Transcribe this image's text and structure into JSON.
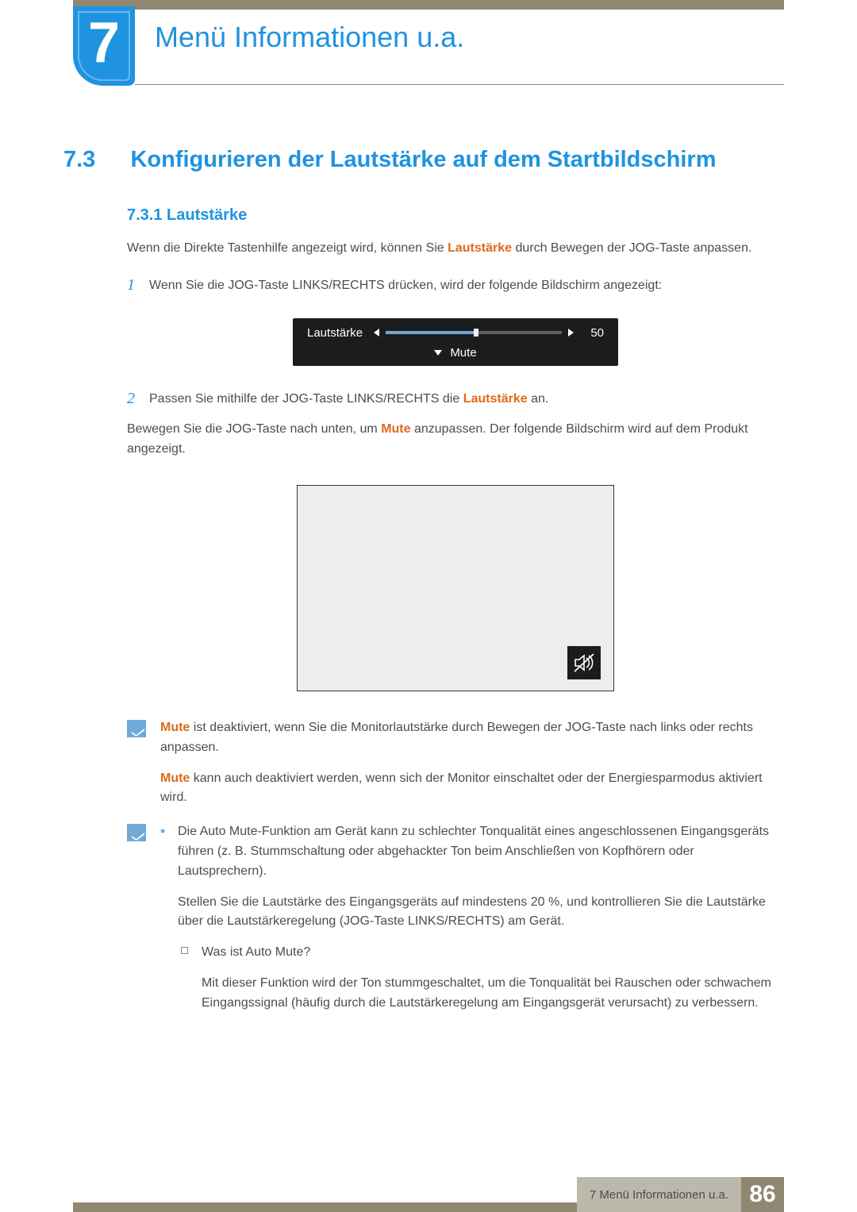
{
  "chapter": {
    "number": "7",
    "title": "Menü Informationen u.a."
  },
  "section": {
    "number": "7.3",
    "title": "Konfigurieren der Lautstärke auf dem Startbildschirm"
  },
  "subsection": {
    "number": "7.3.1",
    "title": "Lautstärke",
    "heading": "7.3.1   Lautstärke"
  },
  "intro": {
    "part1": "Wenn die Direkte Tastenhilfe angezeigt wird, können Sie ",
    "kw": "Lautstärke",
    "part2": " durch Bewegen der JOG-Taste anpassen."
  },
  "step1": {
    "num": "1",
    "text": "Wenn Sie die JOG-Taste LINKS/RECHTS drücken, wird der folgende Bildschirm angezeigt:"
  },
  "osd": {
    "label": "Lautstärke",
    "value": "50",
    "mute": "Mute"
  },
  "step2": {
    "num": "2",
    "part1": "Passen Sie mithilfe der JOG-Taste LINKS/RECHTS die ",
    "kw": "Lautstärke",
    "part2": " an."
  },
  "afterStep2": {
    "part1": "Bewegen Sie die JOG-Taste nach unten, um ",
    "kw": "Mute",
    "part2": " anzupassen. Der folgende Bildschirm wird auf dem Produkt angezeigt."
  },
  "note1": {
    "p1": {
      "kw": "Mute",
      "rest": " ist deaktiviert, wenn Sie die Monitorlautstärke durch Bewegen der JOG-Taste nach links oder rechts anpassen."
    },
    "p2": {
      "kw": "Mute",
      "rest": " kann auch deaktiviert werden, wenn sich der Monitor einschaltet oder der Energiesparmodus aktiviert wird."
    }
  },
  "note2": {
    "b1": "Die Auto Mute-Funktion am Gerät kann zu schlechter Tonqualität eines angeschlossenen Eingangsgeräts führen (z. B. Stummschaltung oder abgehackter Ton beim Anschließen von Kopfhörern oder Lautsprechern).",
    "b1b": "Stellen Sie die Lautstärke des Eingangsgeräts auf mindestens 20 %, und kontrollieren Sie die Lautstärke über die Lautstärkeregelung (JOG-Taste LINKS/RECHTS) am Gerät.",
    "sub_q": "Was ist Auto Mute?",
    "sub_a": "Mit dieser Funktion wird der Ton stummgeschaltet, um die Tonqualität bei Rauschen oder schwachem Eingangssignal (häufig durch die Lautstärkeregelung am Eingangsgerät verursacht) zu verbessern."
  },
  "footer": {
    "text": "7  Menü Informationen u.a.",
    "page": "86"
  }
}
